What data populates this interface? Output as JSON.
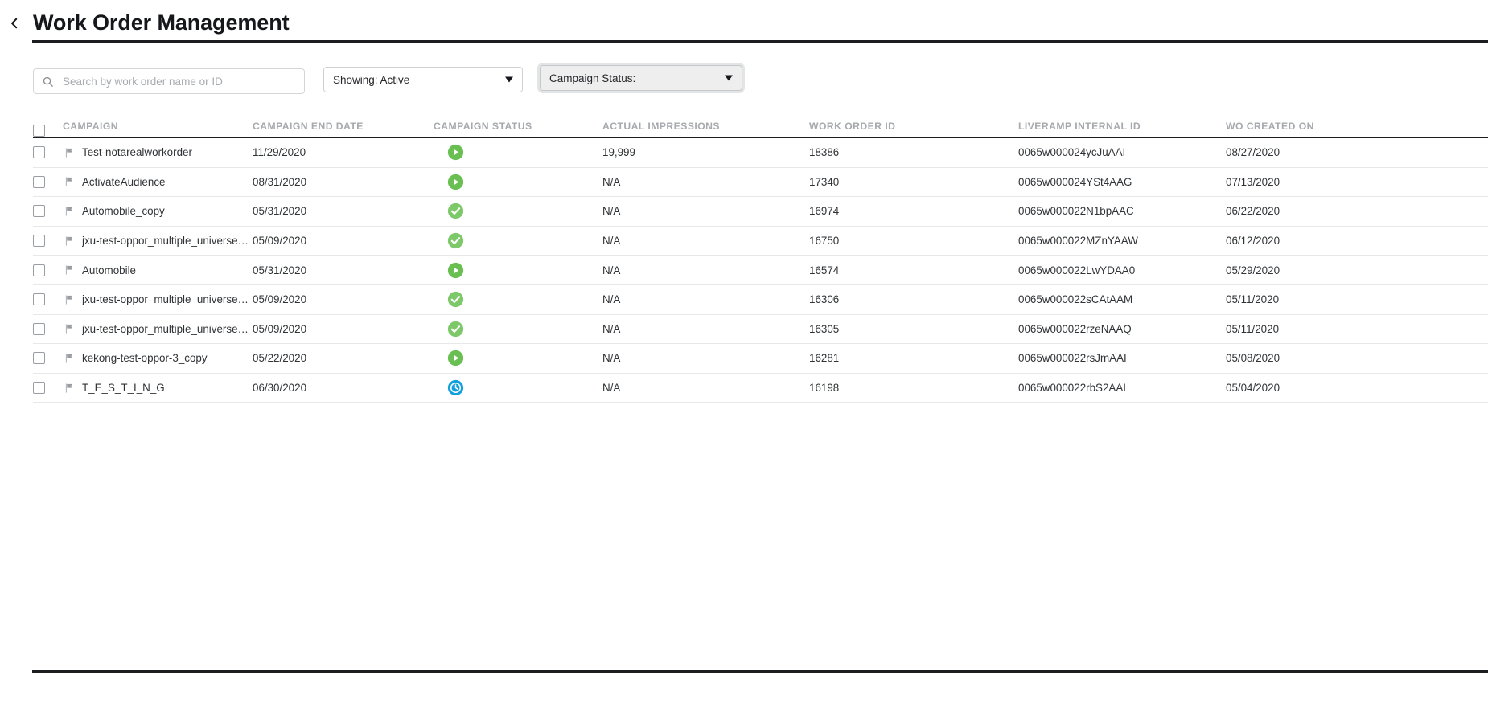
{
  "header": {
    "back_icon": "chevron-left-icon",
    "title": "Work Order Management"
  },
  "filters": {
    "search": {
      "icon": "search-icon",
      "value": "",
      "placeholder": "Search by work order name or ID"
    },
    "showing": {
      "label": "Showing: Active",
      "caret_icon": "caret-down-icon"
    },
    "campaign_status": {
      "label": "Campaign Status:",
      "caret_icon": "caret-down-icon",
      "focused": true
    }
  },
  "table": {
    "select_all_checkbox": "unchecked",
    "columns": [
      "CAMPAIGN",
      "CAMPAIGN END DATE",
      "CAMPAIGN STATUS",
      "ACTUAL IMPRESSIONS",
      "WORK ORDER ID",
      "LIVERAMP INTERNAL ID",
      "WO CREATED ON"
    ],
    "rows": [
      {
        "checked": false,
        "flag_icon": "flag-icon",
        "campaign": "Test-notarealworkorder",
        "campaign_end_date": "11/29/2020",
        "status_icon": "play-circle-icon",
        "status_color": "#6abf53",
        "actual_impressions": "19,999",
        "work_order_id": "18386",
        "liveramp_internal_id": "0065w000024ycJuAAI",
        "wo_created_on": "08/27/2020"
      },
      {
        "checked": false,
        "flag_icon": "flag-icon",
        "campaign": "ActivateAudience",
        "campaign_end_date": "08/31/2020",
        "status_icon": "play-circle-icon",
        "status_color": "#6abf53",
        "actual_impressions": "N/A",
        "work_order_id": "17340",
        "liveramp_internal_id": "0065w000024YSt4AAG",
        "wo_created_on": "07/13/2020"
      },
      {
        "checked": false,
        "flag_icon": "flag-icon",
        "campaign": "Automobile_copy",
        "campaign_end_date": "05/31/2020",
        "status_icon": "check-circle-icon",
        "status_color": "#7dc96a",
        "actual_impressions": "N/A",
        "work_order_id": "16974",
        "liveramp_internal_id": "0065w000022N1bpAAC",
        "wo_created_on": "06/22/2020"
      },
      {
        "checked": false,
        "flag_icon": "flag-icon",
        "campaign": "jxu-test-oppor_multiple_universe_…",
        "campaign_end_date": "05/09/2020",
        "status_icon": "check-circle-icon",
        "status_color": "#7dc96a",
        "actual_impressions": "N/A",
        "work_order_id": "16750",
        "liveramp_internal_id": "0065w000022MZnYAAW",
        "wo_created_on": "06/12/2020"
      },
      {
        "checked": false,
        "flag_icon": "flag-icon",
        "campaign": "Automobile",
        "campaign_end_date": "05/31/2020",
        "status_icon": "play-circle-icon",
        "status_color": "#6abf53",
        "actual_impressions": "N/A",
        "work_order_id": "16574",
        "liveramp_internal_id": "0065w000022LwYDAA0",
        "wo_created_on": "05/29/2020"
      },
      {
        "checked": false,
        "flag_icon": "flag-icon",
        "campaign": "jxu-test-oppor_multiple_universe_…",
        "campaign_end_date": "05/09/2020",
        "status_icon": "check-circle-icon",
        "status_color": "#7dc96a",
        "actual_impressions": "N/A",
        "work_order_id": "16306",
        "liveramp_internal_id": "0065w000022sCAtAAM",
        "wo_created_on": "05/11/2020"
      },
      {
        "checked": false,
        "flag_icon": "flag-icon",
        "campaign": "jxu-test-oppor_multiple_universe_…",
        "campaign_end_date": "05/09/2020",
        "status_icon": "check-circle-icon",
        "status_color": "#7dc96a",
        "actual_impressions": "N/A",
        "work_order_id": "16305",
        "liveramp_internal_id": "0065w000022rzeNAAQ",
        "wo_created_on": "05/11/2020"
      },
      {
        "checked": false,
        "flag_icon": "flag-icon",
        "campaign": "kekong-test-oppor-3_copy",
        "campaign_end_date": "05/22/2020",
        "status_icon": "play-circle-icon",
        "status_color": "#6abf53",
        "actual_impressions": "N/A",
        "work_order_id": "16281",
        "liveramp_internal_id": "0065w000022rsJmAAI",
        "wo_created_on": "05/08/2020"
      },
      {
        "checked": false,
        "flag_icon": "flag-icon",
        "campaign": "T_E_S_T_I_N_G",
        "campaign_end_date": "06/30/2020",
        "status_icon": "clock-circle-icon",
        "status_color": "#12a0dd",
        "actual_impressions": "N/A",
        "work_order_id": "16198",
        "liveramp_internal_id": "0065w000022rbS2AAI",
        "wo_created_on": "05/04/2020"
      }
    ]
  }
}
